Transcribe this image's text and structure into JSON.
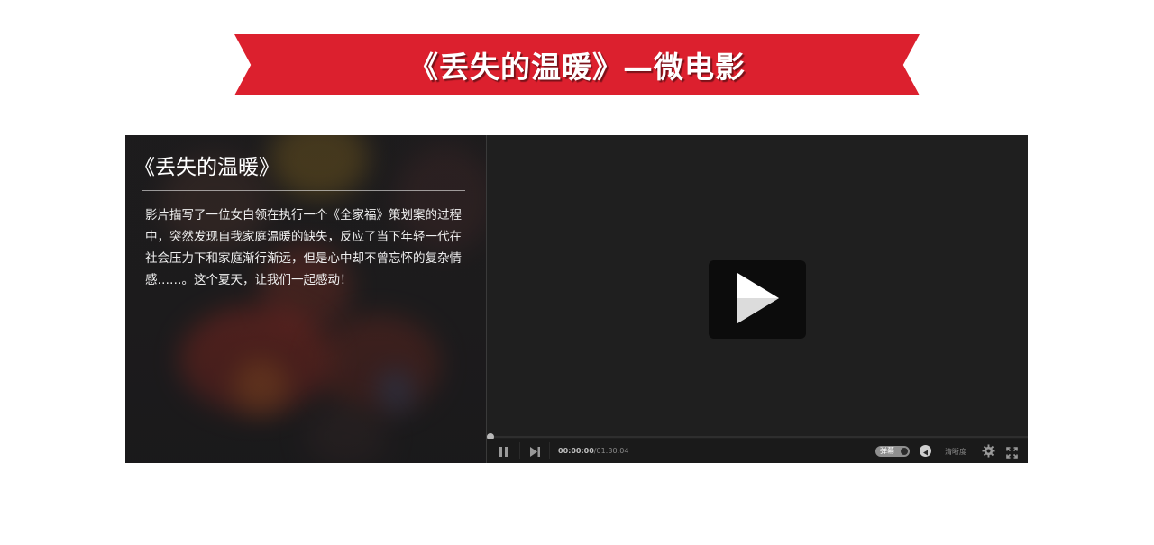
{
  "banner": {
    "title": "《丢失的温暖》—微电影"
  },
  "info": {
    "title": "《丢失的温暖》",
    "description": "影片描写了一位女白领在执行一个《全家福》策划案的过程中，突然发现自我家庭温暖的缺失，反应了当下年轻一代在社会压力下和家庭渐行渐远，但是心中却不曾忘怀的复杂情感……。这个夏天，让我们一起感动！"
  },
  "player": {
    "current_time": "00:00:00",
    "separator": "/",
    "total_time": "01:30:04",
    "danmaku_label": "弹幕",
    "quality_label": "清晰度",
    "progress": 0,
    "icons": {
      "play": "play-icon",
      "pause": "pause-icon",
      "next": "next-icon",
      "send": "send-icon",
      "settings": "gear-icon",
      "fullscreen": "fullscreen-icon"
    }
  },
  "colors": {
    "banner_red": "#dc202e",
    "player_bg": "#1f1f1f",
    "panel_bg": "#1c1b1c"
  }
}
